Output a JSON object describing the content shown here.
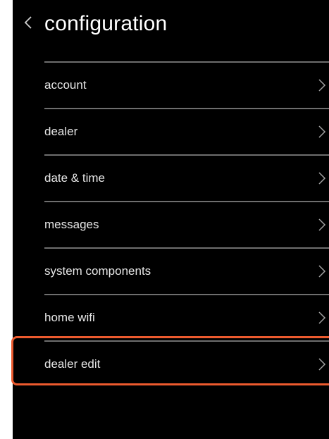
{
  "header": {
    "title": "configuration",
    "back_icon": "chevron-left-icon"
  },
  "menu": {
    "items": [
      {
        "label": "account"
      },
      {
        "label": "dealer"
      },
      {
        "label": "date & time"
      },
      {
        "label": "messages"
      },
      {
        "label": "system components"
      },
      {
        "label": "home wifi"
      },
      {
        "label": "dealer edit",
        "highlighted": true
      }
    ],
    "chevron_icon": "chevron-right-icon"
  },
  "colors": {
    "background": "#000000",
    "text": "#e6e6e6",
    "divider": "#6e6e6e",
    "highlight": "#ec5a2e"
  }
}
